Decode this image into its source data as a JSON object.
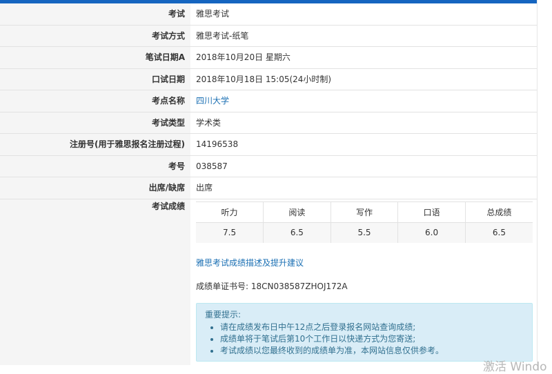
{
  "rows": [
    {
      "label": "考试",
      "value": "雅思考试"
    },
    {
      "label": "考试方式",
      "value": "雅思考试-纸笔"
    },
    {
      "label": "笔试日期A",
      "value": "2018年10月20日 星期六"
    },
    {
      "label": "口试日期",
      "value": "2018年10月18日 15:05(24小时制)"
    },
    {
      "label": "考点名称",
      "value": "四川大学"
    },
    {
      "label": "考试类型",
      "value": "学术类"
    },
    {
      "label": "注册号(用于雅思报名注册过程)",
      "value": "14196538"
    },
    {
      "label": "考号",
      "value": "038587"
    },
    {
      "label": "出席/缺席",
      "value": "出席"
    }
  ],
  "scores": {
    "label": "考试成绩",
    "headers": [
      "听力",
      "阅读",
      "写作",
      "口语",
      "总成绩"
    ],
    "values": [
      "7.5",
      "6.5",
      "5.5",
      "6.0",
      "6.5"
    ],
    "advice_link": "雅思考试成绩描述及提升建议",
    "certificate": "成绩单证书号: 18CN038587ZHOJ172A"
  },
  "notice": {
    "title": "重要提示:",
    "items": [
      "请在成绩发布日中午12点之后登录报名网站查询成绩;",
      "成绩单将于笔试后第10个工作日以快递方式为您寄送;",
      "考试成绩以您最终收到的成绩单为准，本网站信息仅供参考。"
    ]
  },
  "watermark": "激活 Windo",
  "colors": {
    "accent_bar": "#1565c0",
    "link": "#1a6fb3",
    "notice_bg": "#d9edf7",
    "notice_text": "#31708f"
  }
}
